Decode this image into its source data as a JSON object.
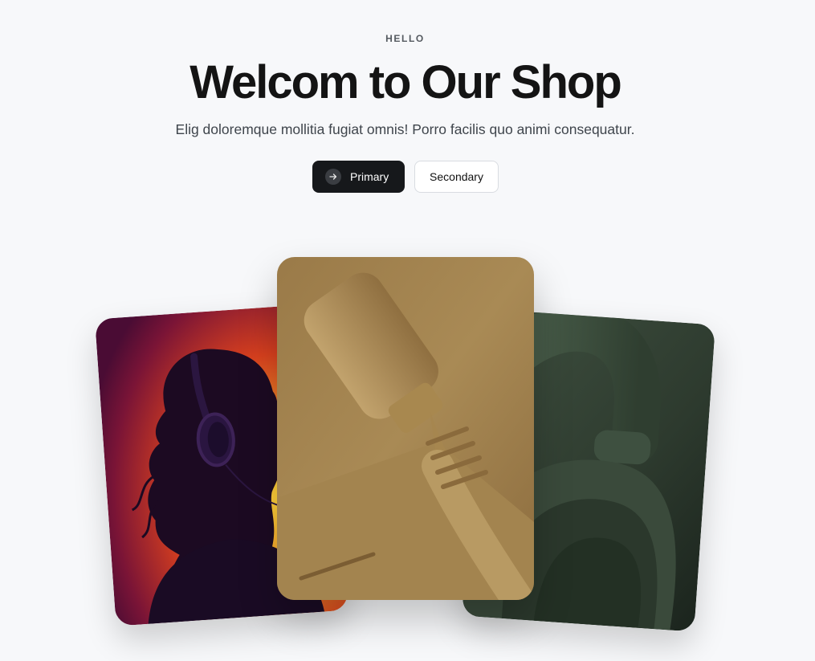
{
  "hero": {
    "eyebrow": "HELLO",
    "title": "Welcom to Our Shop",
    "subtitle": "Elig doloremque mollitia fugiat omnis! Porro facilis quo animi consequatur."
  },
  "actions": {
    "primary_label": "Primary",
    "primary_icon": "arrow-right-icon",
    "secondary_label": "Secondary"
  },
  "colors": {
    "background": "#f7f8fa",
    "primary_button": "#16181b",
    "secondary_border": "#d9dce1",
    "left_card_gradient": [
      "#5a0f3c",
      "#d8401e",
      "#f7a12a"
    ],
    "center_card": "#a98a55",
    "right_card": "#2f3f30"
  },
  "gallery": {
    "left_image": "headphones-silhouette-photo",
    "center_image": "cable-connector-photo",
    "right_image": "headphones-closeup-photo"
  }
}
